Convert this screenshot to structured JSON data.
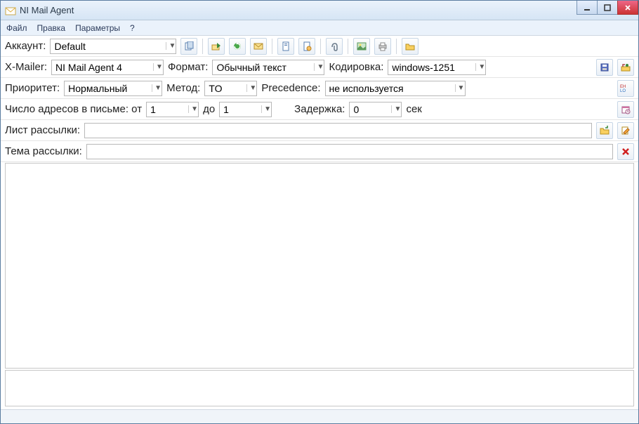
{
  "window": {
    "title": "NI Mail Agent"
  },
  "menu": {
    "file": "Файл",
    "edit": "Правка",
    "params": "Параметры",
    "help": "?"
  },
  "labels": {
    "account": "Аккаунт:",
    "xmailer": "X-Mailer:",
    "format": "Формат:",
    "encoding": "Кодировка:",
    "priority": "Приоритет:",
    "method": "Метод:",
    "precedence": "Precedence:",
    "addr_count": "Число адресов в письме: от",
    "to": "до",
    "delay": "Задержка:",
    "sec": "сек",
    "list": "Лист рассылки:",
    "subject": "Тема рассылки:"
  },
  "values": {
    "account": "Default",
    "xmailer": "NI Mail Agent 4",
    "format": "Обычный текст",
    "encoding": "windows-1251",
    "priority": "Нормальный",
    "method": "TO",
    "precedence": "не используется",
    "addr_from": "1",
    "addr_to": "1",
    "delay": "0",
    "list": "",
    "subject": ""
  },
  "toolbar_icons": {
    "r1": [
      "copy-icon",
      "out-icon",
      "refresh-icon",
      "mail-icon",
      "doc1-icon",
      "doc2-icon",
      "attach-icon",
      "pic-icon",
      "print-icon",
      "folder-icon"
    ]
  }
}
